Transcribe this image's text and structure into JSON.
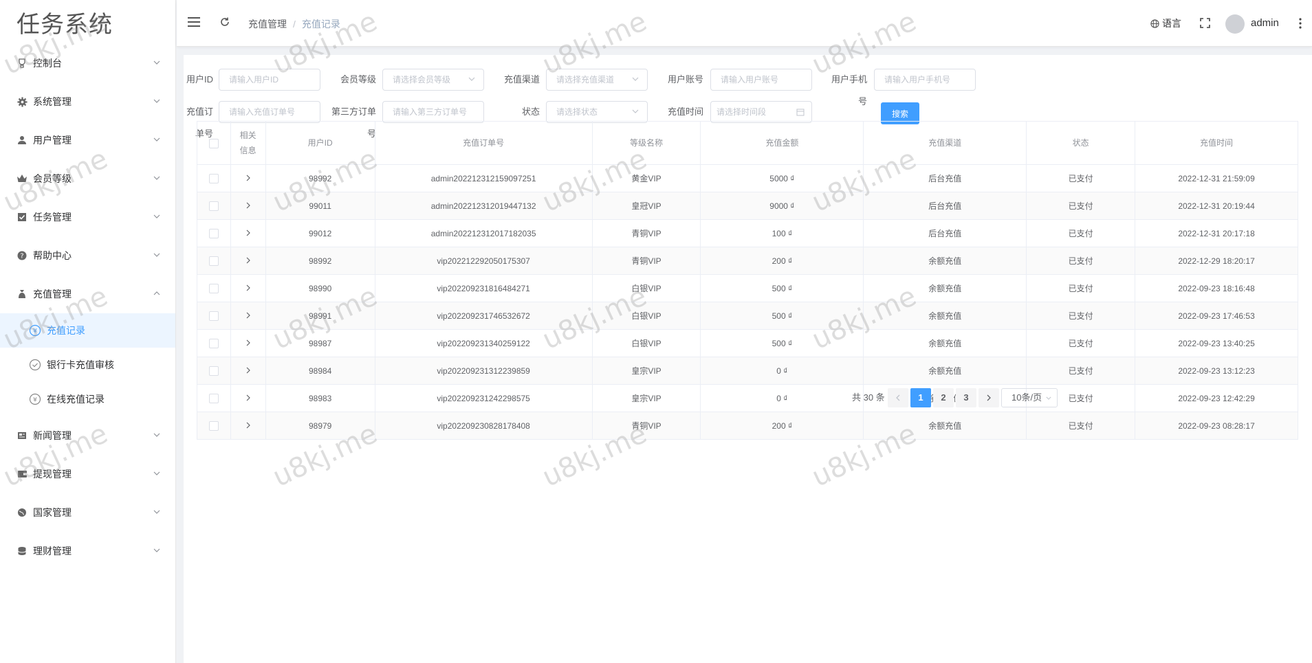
{
  "app": {
    "title": "任务系统"
  },
  "sidebar": {
    "items": [
      {
        "label": "控制台",
        "icon": "trophy-icon"
      },
      {
        "label": "系统管理",
        "icon": "gear-icon"
      },
      {
        "label": "用户管理",
        "icon": "user-icon"
      },
      {
        "label": "会员等级",
        "icon": "crown-icon"
      },
      {
        "label": "任务管理",
        "icon": "checkbox-icon"
      },
      {
        "label": "帮助中心",
        "icon": "question-icon"
      },
      {
        "label": "充值管理",
        "icon": "money-bag-icon"
      }
    ],
    "sub_items": [
      {
        "label": "充值记录",
        "icon": "yen-circle-icon"
      },
      {
        "label": "银行卡充值审核",
        "icon": "check-circle-icon"
      },
      {
        "label": "在线充值记录",
        "icon": "yen-circle-icon"
      }
    ],
    "items_after": [
      {
        "label": "新闻管理",
        "icon": "news-icon"
      },
      {
        "label": "提现管理",
        "icon": "wallet-icon"
      },
      {
        "label": "国家管理",
        "icon": "globe-icon"
      },
      {
        "label": "理财管理",
        "icon": "database-icon"
      }
    ]
  },
  "header": {
    "breadcrumb": [
      "充值管理",
      "充值记录"
    ],
    "language_label": "语言",
    "username": "admin"
  },
  "filters": {
    "user_id": {
      "label": "用户ID",
      "placeholder": "请输入用户ID"
    },
    "member_level": {
      "label": "会员等级",
      "placeholder": "请选择会员等级"
    },
    "channel": {
      "label": "充值渠道",
      "placeholder": "请选择充值渠道"
    },
    "account": {
      "label": "用户账号",
      "placeholder": "请输入用户账号"
    },
    "phone": {
      "label": "用户手机号",
      "placeholder": "请输入用户手机号"
    },
    "order_no": {
      "label": "充值订单号",
      "placeholder": "请输入充值订单号"
    },
    "third_order": {
      "label": "第三方订单号",
      "placeholder": "请输入第三方订单号"
    },
    "status": {
      "label": "状态",
      "placeholder": "请选择状态"
    },
    "time": {
      "label": "充值时间",
      "placeholder": "请选择时间段"
    },
    "search_label": "搜索"
  },
  "table": {
    "columns": [
      "相关\n信息",
      "用户ID",
      "充值订单号",
      "等级名称",
      "充值金额",
      "充值渠道",
      "状态",
      "充值时间"
    ],
    "rows": [
      {
        "user_id": "98992",
        "order_no": "admin202212312159097251",
        "level": "黄金VIP",
        "amount": "5000 ₫",
        "channel": "后台充值",
        "status": "已支付",
        "time": "2022-12-31 21:59:09"
      },
      {
        "user_id": "99011",
        "order_no": "admin202212312019447132",
        "level": "皇冠VIP",
        "amount": "9000 ₫",
        "channel": "后台充值",
        "status": "已支付",
        "time": "2022-12-31 20:19:44"
      },
      {
        "user_id": "99012",
        "order_no": "admin202212312017182035",
        "level": "青铜VIP",
        "amount": "100 ₫",
        "channel": "后台充值",
        "status": "已支付",
        "time": "2022-12-31 20:17:18"
      },
      {
        "user_id": "98992",
        "order_no": "vip202212292050175307",
        "level": "青铜VIP",
        "amount": "200 ₫",
        "channel": "余额充值",
        "status": "已支付",
        "time": "2022-12-29 18:20:17"
      },
      {
        "user_id": "98990",
        "order_no": "vip202209231816484271",
        "level": "白银VIP",
        "amount": "500 ₫",
        "channel": "余额充值",
        "status": "已支付",
        "time": "2022-09-23 18:16:48"
      },
      {
        "user_id": "98991",
        "order_no": "vip202209231746532672",
        "level": "白银VIP",
        "amount": "500 ₫",
        "channel": "余额充值",
        "status": "已支付",
        "time": "2022-09-23 17:46:53"
      },
      {
        "user_id": "98987",
        "order_no": "vip202209231340259122",
        "level": "白银VIP",
        "amount": "500 ₫",
        "channel": "余额充值",
        "status": "已支付",
        "time": "2022-09-23 13:40:25"
      },
      {
        "user_id": "98984",
        "order_no": "vip202209231312239859",
        "level": "皇宗VIP",
        "amount": "0 ₫",
        "channel": "余额充值",
        "status": "已支付",
        "time": "2022-09-23 13:12:23"
      },
      {
        "user_id": "98983",
        "order_no": "vip202209231242298575",
        "level": "皇宗VIP",
        "amount": "0 ₫",
        "channel": "余额充值",
        "status": "已支付",
        "time": "2022-09-23 12:42:29"
      },
      {
        "user_id": "98979",
        "order_no": "vip202209230828178408",
        "level": "青铜VIP",
        "amount": "200 ₫",
        "channel": "余额充值",
        "status": "已支付",
        "time": "2022-09-23 08:28:17"
      }
    ]
  },
  "pagination": {
    "total_label": "共 30 条",
    "pages": [
      "1",
      "2",
      "3"
    ],
    "current": "1",
    "page_size": "10条/页"
  },
  "watermark": "u8kj.me",
  "colors": {
    "primary": "#409eff",
    "active_bg": "#ecf5ff"
  }
}
